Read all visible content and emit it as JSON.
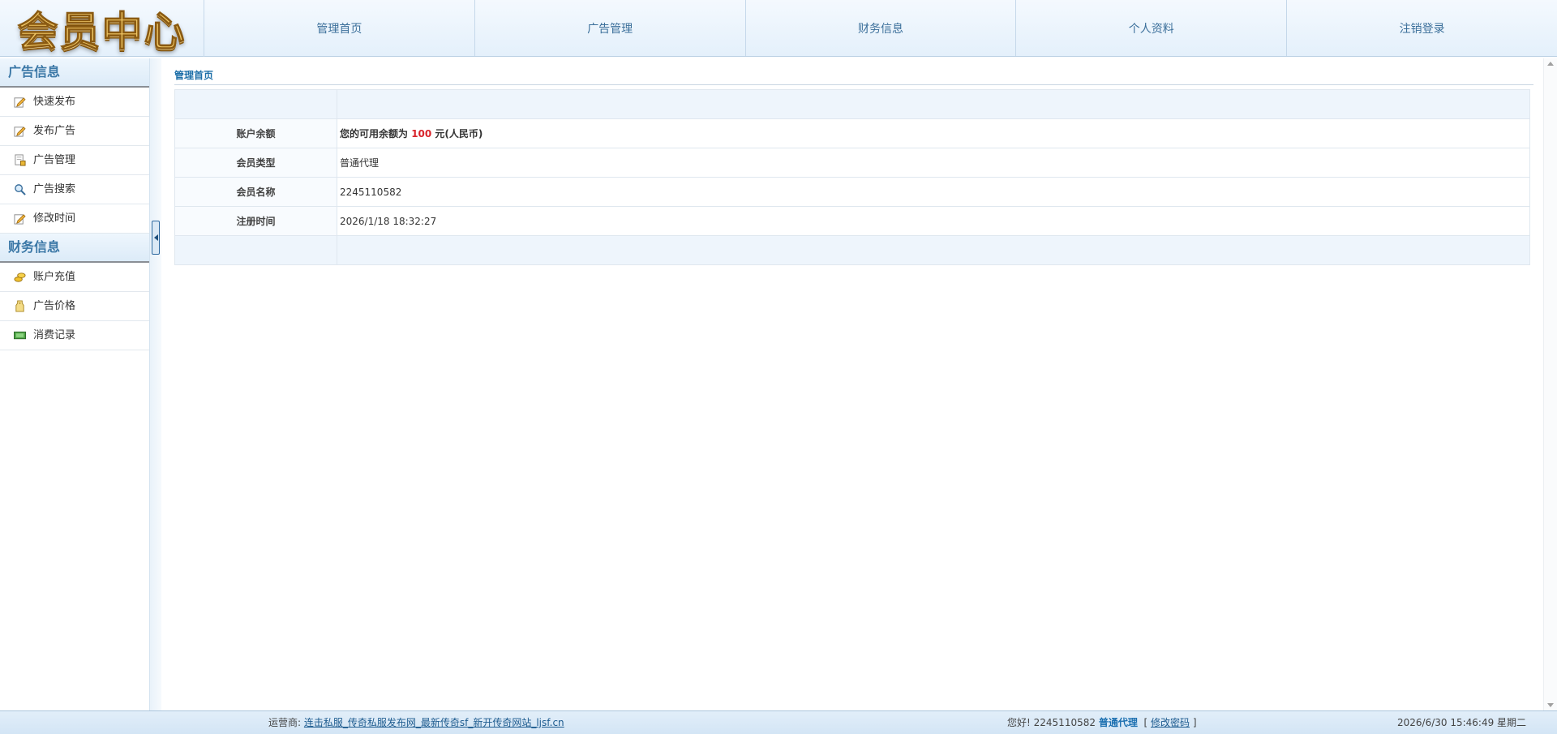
{
  "header": {
    "logo_text": "会员中心",
    "nav": [
      "管理首页",
      "广告管理",
      "财务信息",
      "个人资料",
      "注销登录"
    ]
  },
  "sidebar": {
    "groups": [
      {
        "title": "广告信息",
        "items": [
          {
            "label": "快速发布",
            "icon": "edit-icon"
          },
          {
            "label": "发布广告",
            "icon": "edit-icon"
          },
          {
            "label": "广告管理",
            "icon": "document-lock-icon"
          },
          {
            "label": "广告搜索",
            "icon": "magnifier-icon"
          },
          {
            "label": "修改时间",
            "icon": "edit-icon"
          }
        ]
      },
      {
        "title": "财务信息",
        "items": [
          {
            "label": "账户充值",
            "icon": "coins-icon"
          },
          {
            "label": "广告价格",
            "icon": "price-tag-icon"
          },
          {
            "label": "消费记录",
            "icon": "banknote-icon"
          }
        ]
      }
    ]
  },
  "main": {
    "breadcrumb": "管理首页",
    "rows": [
      {
        "label": "账户余额",
        "prefix": "您的可用余额为 ",
        "amount": "100",
        "suffix": " 元(人民币)"
      },
      {
        "label": "会员类型",
        "value": "普通代理"
      },
      {
        "label": "会员名称",
        "value": "2245110582"
      },
      {
        "label": "注册时间",
        "value": "2026/1/18 18:32:27"
      }
    ]
  },
  "footer": {
    "operator_label": "运营商:",
    "operator_link": "连击私服_传奇私服发布网_最新传奇sf_新开传奇网站_ljsf.cn",
    "greeting": "您好!",
    "username": "2245110582",
    "member_type": "普通代理",
    "bracket_open": "[",
    "change_password": "修改密码",
    "bracket_close": "]",
    "datetime": "2026/6/30 15:46:49 星期二"
  },
  "colors": {
    "accent": "#1b6fb0",
    "amount": "#d8242b",
    "header_bg": "#e4f0fb"
  }
}
